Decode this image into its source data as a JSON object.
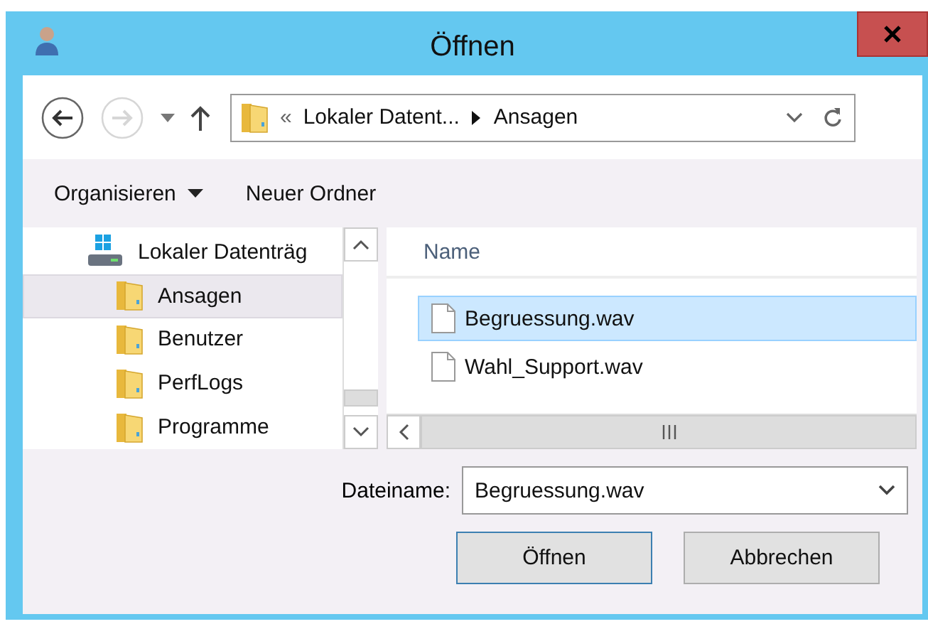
{
  "window": {
    "title": "Öffnen"
  },
  "nav_buttons": [
    {
      "kind": "back",
      "disabled": false
    },
    {
      "kind": "forward",
      "disabled": true
    },
    {
      "kind": "recent",
      "disabled": false
    },
    {
      "kind": "up",
      "disabled": false
    }
  ],
  "address_bar": {
    "overflow": "«",
    "segments": [
      "Lokaler Datent...",
      "Ansagen"
    ]
  },
  "command_bar": [
    {
      "label": "Organisieren",
      "kind": "menu"
    },
    {
      "label": "Neuer Ordner",
      "kind": "button"
    }
  ],
  "nav_pane": {
    "items": [
      {
        "label": "Lokaler Datenträg",
        "kind": "drive",
        "selected": false,
        "children": [
          {
            "label": "Ansagen",
            "kind": "folder",
            "selected": true
          },
          {
            "label": "Benutzer",
            "kind": "folder",
            "selected": false
          },
          {
            "label": "PerfLogs",
            "kind": "folder",
            "selected": false
          },
          {
            "label": "Programme",
            "kind": "folder",
            "selected": false
          }
        ]
      }
    ]
  },
  "file_list": {
    "columns": [
      "Name"
    ],
    "rows": [
      {
        "name": "Begruessung.wav",
        "selected": true
      },
      {
        "name": "Wahl_Support.wav",
        "selected": false
      }
    ]
  },
  "file_name": {
    "label": "Dateiname:",
    "value": "Begruessung.wav"
  },
  "buttons": [
    {
      "label": "Öffnen",
      "default": true
    },
    {
      "label": "Abbrechen",
      "default": false
    }
  ]
}
